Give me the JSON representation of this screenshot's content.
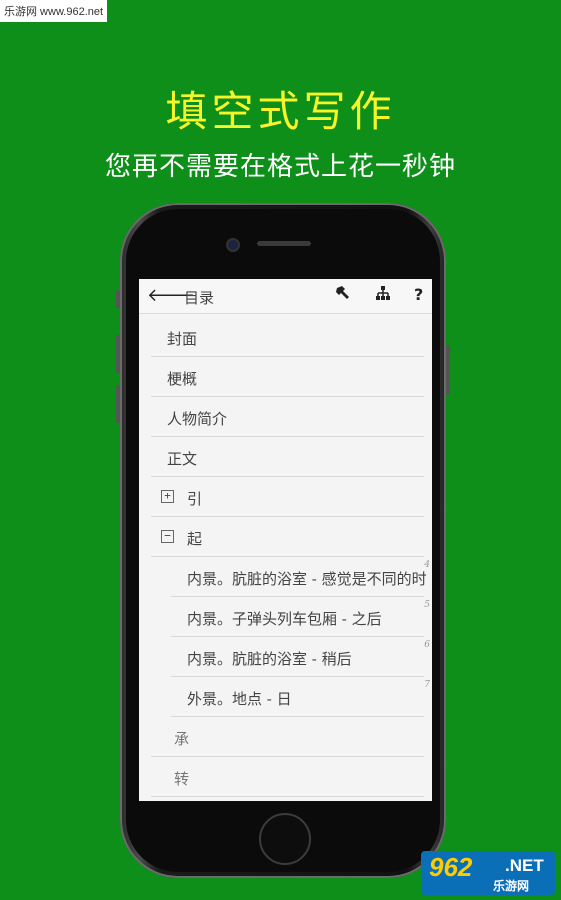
{
  "watermark": "乐游网 www.962.net",
  "headline": "填空式写作",
  "subline": "您再不需要在格式上花一秒钟",
  "app": {
    "toolbar": {
      "back_icon": "arrow-left-icon",
      "title": "目录",
      "tools": [
        "hammer-icon",
        "hierarchy-icon",
        "help-icon"
      ],
      "help_glyph": "?"
    },
    "outline": [
      {
        "label": "封面",
        "level": 0
      },
      {
        "label": "梗概",
        "level": 0
      },
      {
        "label": "人物简介",
        "level": 0
      },
      {
        "label": "正文",
        "level": 0
      },
      {
        "label": "引",
        "level": 1,
        "toggle": "⊞"
      },
      {
        "label": "起",
        "level": 1,
        "toggle": "⊟"
      },
      {
        "label": "内景。肮脏的浴室 - 感觉是不同的时",
        "level": 2,
        "num": "4"
      },
      {
        "label": "内景。子弹头列车包厢 - 之后",
        "level": 2,
        "num": "5"
      },
      {
        "label": "内景。肮脏的浴室 - 稍后",
        "level": 2,
        "num": "6"
      },
      {
        "label": "外景。地点 - 日",
        "level": 2,
        "num": "7"
      },
      {
        "label": "承",
        "level": 1
      },
      {
        "label": "转",
        "level": 1
      }
    ]
  },
  "logo": {
    "big": "962",
    "net": ".NET",
    "cn": "乐游网"
  }
}
